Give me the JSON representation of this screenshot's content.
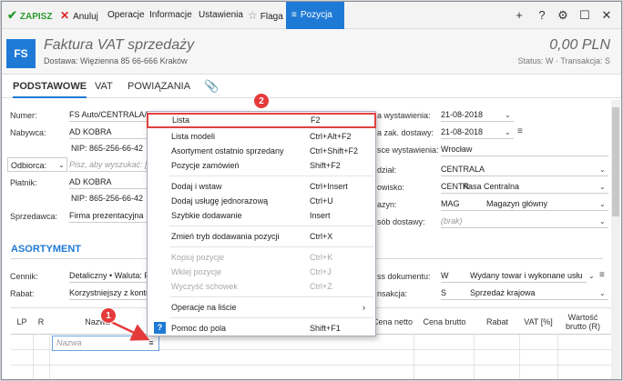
{
  "toolbar": {
    "save": "ZAPISZ",
    "cancel": "Anuluj",
    "operations": "Operacje",
    "info": "Informacje",
    "settings": "Ustawienia",
    "flag": "Flaga",
    "position": "Pozycja"
  },
  "header": {
    "badge": "FS",
    "title": "Faktura VAT sprzedaży",
    "address": "Dostawa: Więzienna  85  66-666 Kraków",
    "amount": "0,00 PLN",
    "status": "Status: W  ·  Transakcja: S"
  },
  "tabs": [
    "PODSTAWOWE",
    "VAT",
    "POWIĄZANIA"
  ],
  "form_left": {
    "number_label": "Numer:",
    "number_value": "FS Auto/CENTRALA/",
    "buyer_label": "Nabywca:",
    "buyer_value": "AD KOBRA",
    "buyer_nip": "NIP:  865-256-66-42",
    "receiver_label": "Odbiorca:",
    "receiver_placeholder": "Pisz, aby wyszukać: [",
    "payer_label": "Płatnik:",
    "payer_value": "AD KOBRA",
    "payer_nip": "NIP:  865-256-66-42",
    "seller_label": "Sprzedawca:",
    "seller_value": "Firma prezentacyjna"
  },
  "form_right": {
    "issue_date_label": "a wystawienia:",
    "issue_date_value": "21-08-2018",
    "purchase_date_label": "a zak. dostawy:",
    "purchase_date_value": "21-08-2018",
    "issue_place_label": "sce wystawienia:",
    "issue_place_value": "Wrocław",
    "dept_label": "dział:",
    "dept_value": "CENTRALA",
    "station_label": "owisko:",
    "station_code": "CENTR",
    "station_name": "Kasa Centralna",
    "warehouse_label": "azyn:",
    "warehouse_code": "MAG",
    "warehouse_name": "Magazyn główny",
    "delivery_label": "sób dostawy:",
    "delivery_value": "(brak)"
  },
  "assortment": {
    "title": "ASORTYMENT",
    "pricelist_label": "Cennik:",
    "pricelist_value": "Detaliczny • Waluta: P",
    "discount_label": "Rabat:",
    "discount_value": "Korzystniejszy z kontr",
    "doctype_label": "ss dokumentu:",
    "doctype_code": "W",
    "doctype_name": "Wydany towar i wykonane usłu",
    "transaction_label": "nsakcja:",
    "transaction_code": "S",
    "transaction_name": "Sprzedaż krajowa"
  },
  "table": {
    "headers": [
      "LP",
      "R",
      "Nazwa",
      "Cena netto",
      "Cena brutto",
      "Rabat",
      "VAT [%]",
      "Wartość brutto (R)"
    ],
    "name_placeholder": "Nazwa"
  },
  "context_menu": {
    "items": [
      {
        "label": "Lista",
        "shortcut": "F2"
      },
      {
        "label": "Lista modeli",
        "shortcut": "Ctrl+Alt+F2"
      },
      {
        "label": "Asortyment ostatnio sprzedany",
        "shortcut": "Ctrl+Shift+F2"
      },
      {
        "label": "Pozycje zamówień",
        "shortcut": "Shift+F2"
      },
      {
        "label": "Dodaj i wstaw",
        "shortcut": "Ctrl+Insert"
      },
      {
        "label": "Dodaj usługę jednorazową",
        "shortcut": "Ctrl+U"
      },
      {
        "label": "Szybkie dodawanie",
        "shortcut": "Insert"
      },
      {
        "label": "Zmień tryb dodawania pozycji",
        "shortcut": "Ctrl+X"
      },
      {
        "label": "Kopiuj pozycje",
        "shortcut": "Ctrl+K"
      },
      {
        "label": "Wklej pozycje",
        "shortcut": "Ctrl+J"
      },
      {
        "label": "Wyczyść schowek",
        "shortcut": "Ctrl+Z"
      },
      {
        "label": "Operacje na liście",
        "shortcut": "›"
      },
      {
        "label": "Pomoc do pola",
        "shortcut": "Shift+F1"
      }
    ]
  },
  "annotations": {
    "badge1": "1",
    "badge2": "2"
  },
  "colors": {
    "accent": "#1f7ad6",
    "highlight": "#e04040",
    "save": "#2d9a32"
  }
}
